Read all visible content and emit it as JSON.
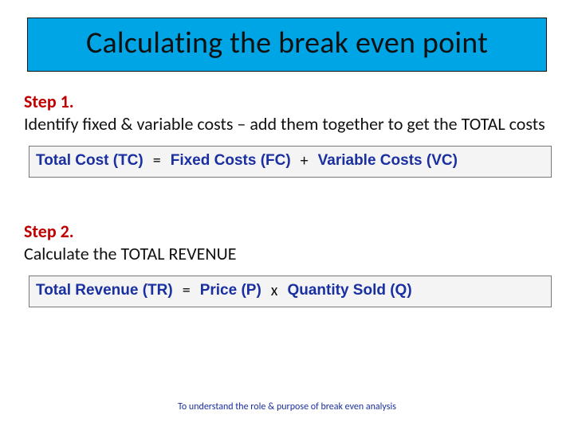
{
  "title": "Calculating the break even point",
  "step1": {
    "label": "Step 1.",
    "desc": "Identify fixed & variable costs – add them together to get the TOTAL costs",
    "formula": {
      "lhs": "Total Cost (TC)",
      "op1": "=",
      "rhs1": "Fixed Costs (FC)",
      "op2": "+",
      "rhs2": "Variable Costs (VC)"
    }
  },
  "step2": {
    "label": "Step 2.",
    "desc": "Calculate the TOTAL REVENUE",
    "formula": {
      "lhs": "Total Revenue (TR)",
      "op1": "=",
      "rhs1": "Price (P)",
      "op2": "x",
      "rhs2": "Quantity Sold (Q)"
    }
  },
  "footer": "To understand the role & purpose of break even analysis"
}
